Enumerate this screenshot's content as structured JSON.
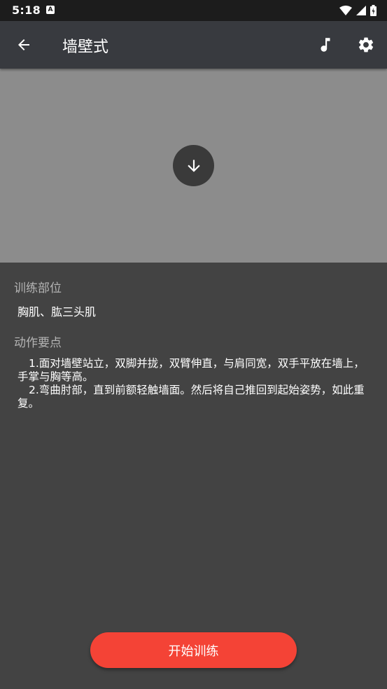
{
  "status_bar": {
    "time": "5:18",
    "notification_icon": "a-icon",
    "icons": [
      "wifi-icon",
      "signal-icon",
      "battery-icon"
    ]
  },
  "app_bar": {
    "title": "墙壁式",
    "back_icon": "arrow-back-icon",
    "music_icon": "music-note-icon",
    "settings_icon": "gear-icon"
  },
  "media": {
    "download_icon": "arrow-down-icon"
  },
  "training_area": {
    "label": "训练部位",
    "value": "胸肌、肱三头肌"
  },
  "key_points": {
    "label": "动作要点",
    "steps": [
      "1.面对墙壁站立，双脚并拢，双臂伸直，与肩同宽，双手平放在墙上，手掌与胸等高。",
      "2.弯曲肘部，直到前额轻触墙面。然后将自己推回到起始姿势，如此重复。"
    ]
  },
  "start_button": {
    "label": "开始训练"
  },
  "colors": {
    "background": "#434343",
    "app_bar": "#383a3f",
    "media_area": "#8c8c8c",
    "accent": "#f44336"
  }
}
